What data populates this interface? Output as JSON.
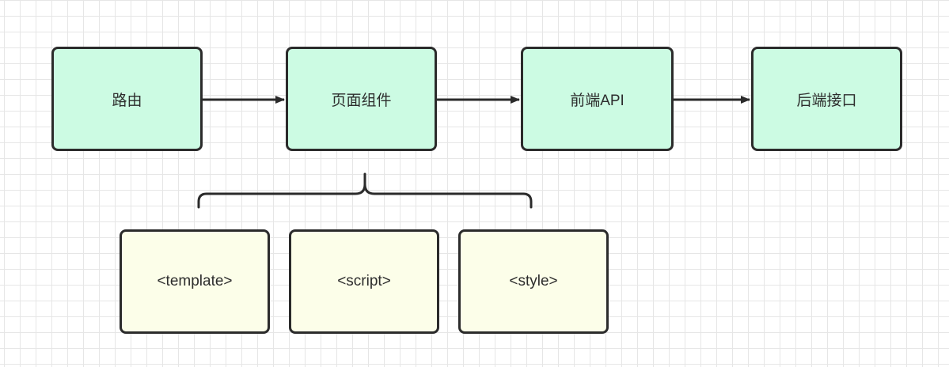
{
  "diagram": {
    "nodes": {
      "router": "路由",
      "page_component": "页面组件",
      "frontend_api": "前端API",
      "backend_api": "后端接口",
      "template": "<template>",
      "script": "<script>",
      "style": "<style>"
    },
    "colors": {
      "main_fill": "#ccfbe3",
      "sub_fill": "#fcfee9",
      "stroke": "#2b2b2b",
      "grid": "#e6e6e6",
      "text": "#2d2d2d"
    }
  }
}
